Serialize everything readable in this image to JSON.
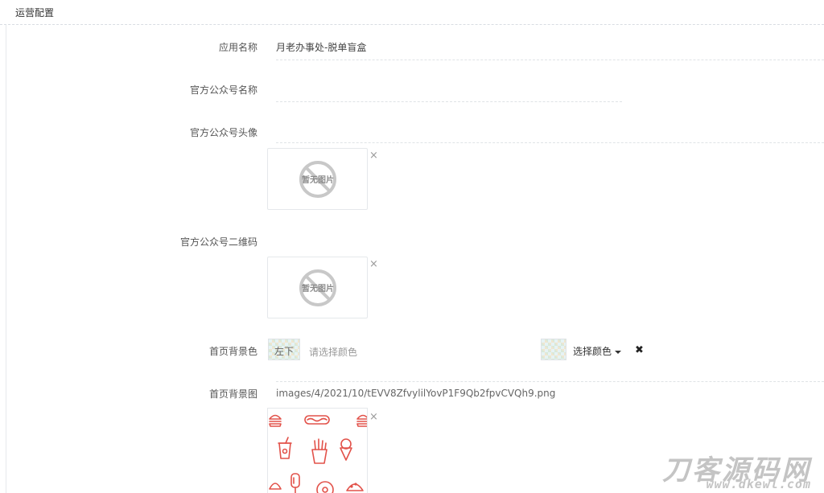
{
  "panel": {
    "title": "运营配置"
  },
  "form": {
    "app_name": {
      "label": "应用名称",
      "value": "月老办事处-脱单盲盒"
    },
    "official_name": {
      "label": "官方公众号名称",
      "value": ""
    },
    "official_avatar": {
      "label": "官方公众号头像",
      "image_placeholder": "暂无图片",
      "remove": "×"
    },
    "official_qrcode": {
      "label": "官方公众号二维码",
      "image_placeholder": "暂无图片",
      "remove": "×"
    },
    "home_bg_color": {
      "label": "首页背景色",
      "swatch_text": "左下",
      "placeholder": "请选择颜色",
      "select_label": "选择颜色",
      "clear": "✖"
    },
    "home_bg_image": {
      "label": "首页背景图",
      "path": "images/4/2021/10/tEVV8ZfvylilYovP1F9Qb2fpvCVQh9.png",
      "remove": "×",
      "icon_color": "#e2524a"
    }
  },
  "watermark": {
    "main": "刀客源码网",
    "sub": "www.dkewl.com"
  },
  "colors": {
    "accent_red": "#e2524a",
    "border": "#e5e8eb"
  }
}
